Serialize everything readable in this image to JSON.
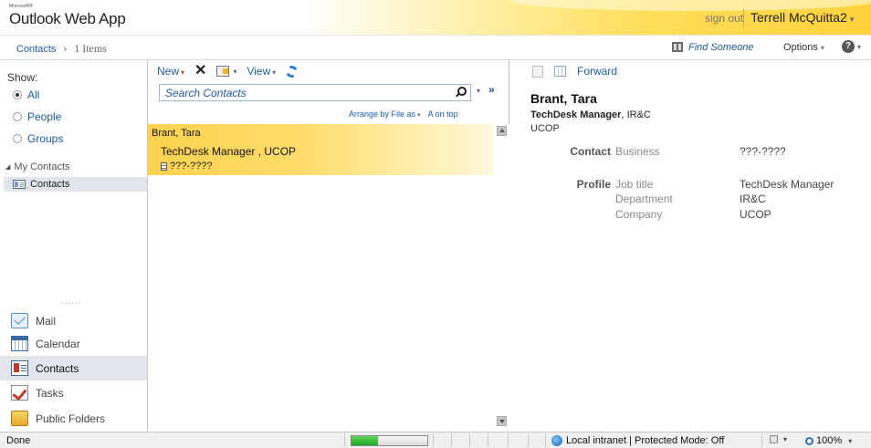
{
  "header": {
    "brand_small": "Microsoft®",
    "app_name": "Outlook Web App",
    "sign_out": "sign out",
    "user_name": "Terrell McQuitta2",
    "user_caret": "▾"
  },
  "breadcrumb": {
    "folder": "Contacts",
    "separator": "›",
    "count": "1 Items",
    "find_someone": "Find Someone",
    "options": "Options",
    "options_caret": "▾",
    "help": "?",
    "help_caret": "▾"
  },
  "leftnav": {
    "show_label": "Show:",
    "filters": [
      {
        "label": "All",
        "selected": true
      },
      {
        "label": "People",
        "selected": false
      },
      {
        "label": "Groups",
        "selected": false
      }
    ],
    "my_contacts": "My Contacts",
    "folder_contacts": "Contacts",
    "grip": "......",
    "modules": [
      {
        "label": "Mail",
        "icon": "mail-icon"
      },
      {
        "label": "Calendar",
        "icon": "calendar-icon"
      },
      {
        "label": "Contacts",
        "icon": "contacts-icon",
        "selected": true
      },
      {
        "label": "Tasks",
        "icon": "tasks-icon"
      },
      {
        "label": "Public Folders",
        "icon": "public-folders-icon"
      }
    ]
  },
  "toolbar": {
    "new_label": "New",
    "delete_label": "✕",
    "view_label": "View",
    "caret": "▾"
  },
  "search": {
    "placeholder": "Search Contacts",
    "value": "",
    "dropdown": "▾",
    "expand": "»"
  },
  "arrange": {
    "by_label": "Arrange by File as",
    "order_label": "A on top",
    "caret": "▾"
  },
  "list": {
    "items": [
      {
        "name": "Brant, Tara",
        "title": "TechDesk Manager , UCOP",
        "phone": "???-????"
      }
    ]
  },
  "reading": {
    "forward": "Forward",
    "name": "Brant, Tara",
    "job_title": "TechDesk Manager",
    "sub_rest": ", IR&C",
    "company": "UCOP",
    "sections": {
      "contact": "Contact",
      "profile": "Profile"
    },
    "contact_fields": [
      {
        "label": "Business",
        "value": "???-????"
      }
    ],
    "profile_fields": [
      {
        "label": "Job title",
        "value": "TechDesk Manager"
      },
      {
        "label": "Department",
        "value": "IR&C"
      },
      {
        "label": "Company",
        "value": "UCOP"
      }
    ]
  },
  "statusbar": {
    "done": "Done",
    "progress_fraction": 0.35,
    "zone": "Local intranet | Protected Mode: Off",
    "caret": "▾",
    "zoom": "100%"
  },
  "colors": {
    "accent_blue": "#1e5aa8",
    "selection_yellow": "#fed24e",
    "progress_green": "#1fa81f"
  }
}
